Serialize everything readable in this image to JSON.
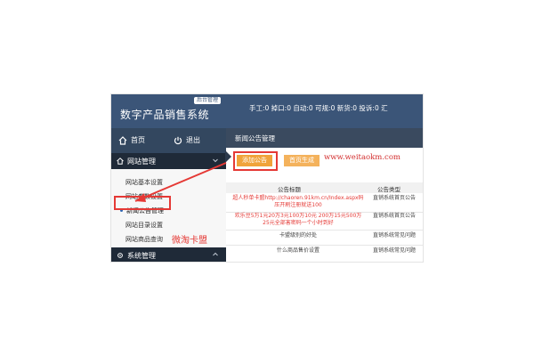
{
  "brand": {
    "badge": "后台管理",
    "title": "数字产品销售系统"
  },
  "quickbar": {
    "home_label": "首页",
    "logout_label": "退出"
  },
  "sidebar": {
    "site_section": "网站管理",
    "items": [
      {
        "label": "网站基本设置"
      },
      {
        "label": "网站参数设置"
      },
      {
        "label": "新闻公告管理"
      },
      {
        "label": "网站目录设置"
      },
      {
        "label": "网站商品查询"
      }
    ],
    "system_section": "系统管理"
  },
  "topbar": {
    "counts": "手工:0   掉口:0   自动:0   可规:0   新货:0   投诉:0   汇"
  },
  "content": {
    "breadcrumb": "新闻公告管理",
    "add_button": "添加公告",
    "generate_button": "首页生成",
    "url_annotation": "www.weitaokm.com",
    "table": {
      "headers": [
        "公告标题",
        "公告类型"
      ],
      "rows": [
        {
          "title": "超人秒单卡盟http://chaoren.91km.cn/Index.aspx码压开刷注册就送100",
          "type": "直销系统首页公告"
        },
        {
          "title": "欢乐豆5万1元20万3元100万10元 200万15元500万25元全部害密码一个小时到好",
          "type": "直销系统首页公告"
        },
        {
          "title": "卡盟级别的好处",
          "type": "直销系统常见问题"
        },
        {
          "title": "什么商品售价设置",
          "type": "直销系统常见问题"
        }
      ]
    }
  },
  "annotation": {
    "watermark": "微淘卡盟"
  }
}
